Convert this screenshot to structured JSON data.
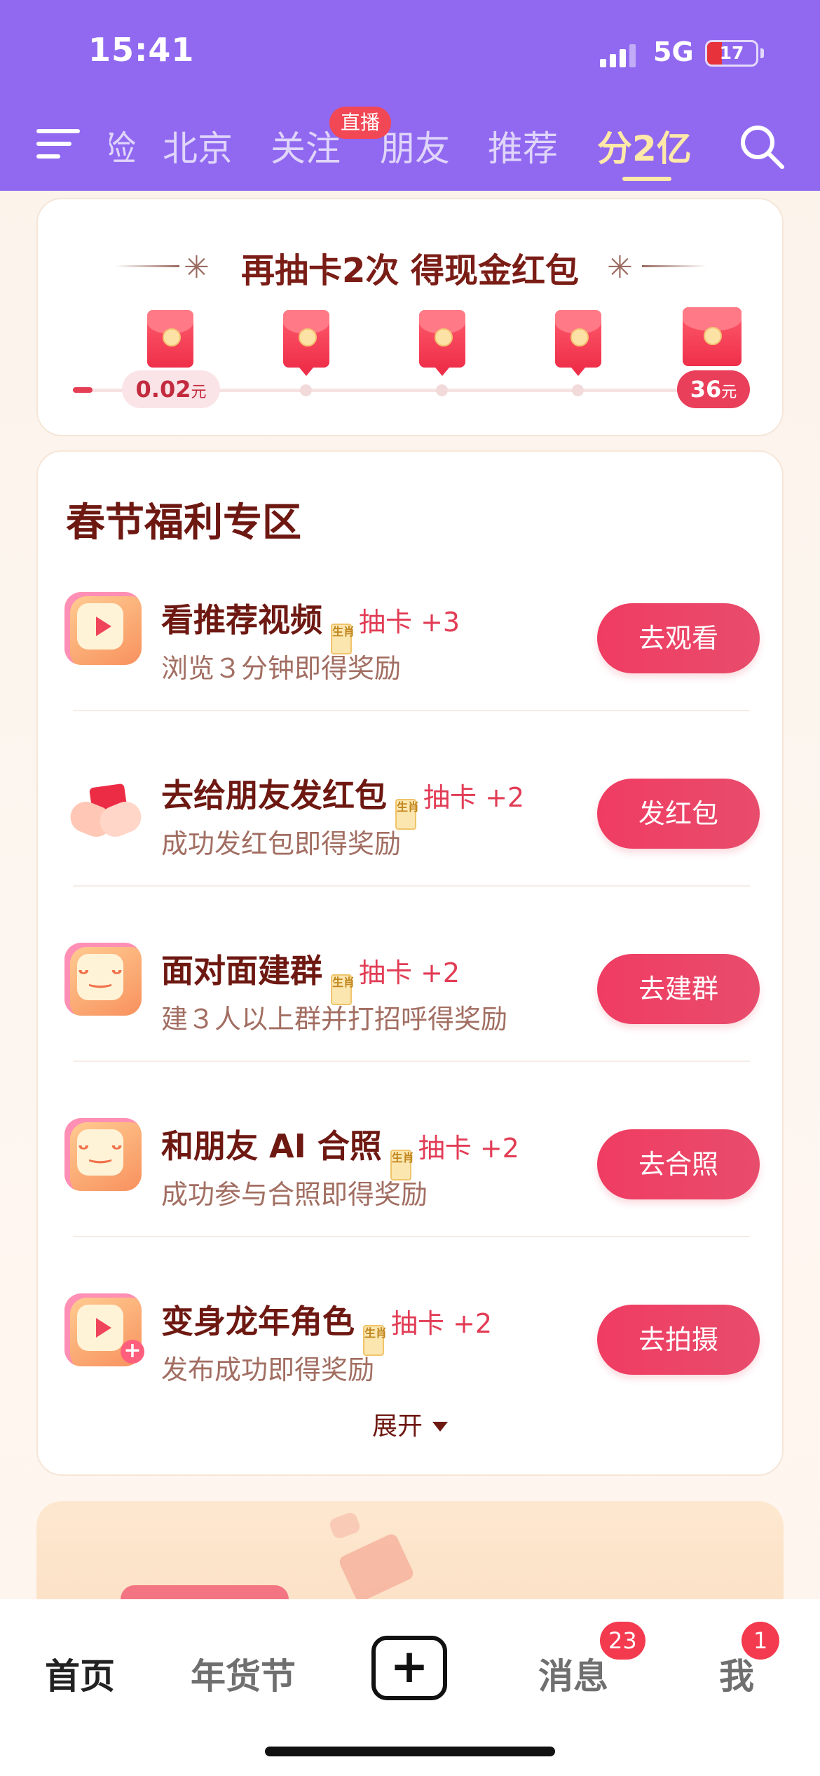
{
  "status_bar": {
    "time": "15:41",
    "network": "5G",
    "battery": "17"
  },
  "top_nav": {
    "tabs": [
      "险",
      "北京",
      "关注",
      "朋友",
      "推荐",
      "分2亿"
    ],
    "live_badge": "直播",
    "active_tab": "分2亿"
  },
  "draw_card": {
    "title": "再抽卡2次 得现金红包",
    "start_amount": "0.02",
    "end_amount": "36",
    "unit": "元",
    "progress_fraction": 0.02
  },
  "welfare": {
    "title": "春节福利专区",
    "card_badge": "生肖",
    "tasks": [
      {
        "title": "看推荐视频",
        "draw": "抽卡 +3",
        "subtitle": "浏览３分钟即得奖励",
        "button": "去观看",
        "icon": "play-video-icon"
      },
      {
        "title": "去给朋友发红包",
        "draw": "抽卡 +2",
        "subtitle": "成功发红包即得奖励",
        "button": "发红包",
        "icon": "red-packet-hands-icon"
      },
      {
        "title": "面对面建群",
        "draw": "抽卡 +2",
        "subtitle": "建３人以上群并打招呼得奖励",
        "button": "去建群",
        "icon": "group-faces-icon"
      },
      {
        "title": "和朋友 AI 合照",
        "draw": "抽卡 +2",
        "subtitle": "成功参与合照即得奖励",
        "button": "去合照",
        "icon": "group-faces-icon"
      },
      {
        "title": "变身龙年角色",
        "draw": "抽卡 +2",
        "subtitle": "发布成功即得奖励",
        "button": "去拍摄",
        "icon": "video-plus-icon"
      }
    ],
    "expand": "展开"
  },
  "bottom_nav": {
    "home": "首页",
    "festival": "年货节",
    "plus": "+",
    "messages": "消息",
    "messages_badge": "23",
    "me": "我",
    "me_badge": "1"
  },
  "colors": {
    "header": "#9169f0",
    "accent": "#ee3e60",
    "title": "#6e1812"
  }
}
